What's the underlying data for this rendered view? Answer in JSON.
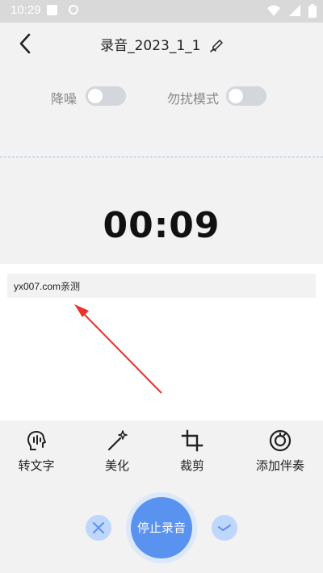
{
  "status_bar": {
    "time": "10:29",
    "icons": [
      "notification-icon",
      "sync-icon",
      "wifi-icon",
      "signal-icon",
      "battery-icon"
    ]
  },
  "header": {
    "title": "录音_2023_1_1",
    "back_icon": "chevron-left-icon",
    "edit_icon": "edit-pen-icon"
  },
  "toggles": [
    {
      "label": "降噪",
      "on": false
    },
    {
      "label": "勿扰模式",
      "on": false
    }
  ],
  "timer": "00:09",
  "transcript": {
    "text": "yx007.com亲测"
  },
  "tools": [
    {
      "label": "转文字",
      "icon": "speech-to-text-icon"
    },
    {
      "label": "美化",
      "icon": "magic-wand-icon"
    },
    {
      "label": "裁剪",
      "icon": "crop-icon"
    },
    {
      "label": "添加伴奏",
      "icon": "music-disc-icon"
    }
  ],
  "controls": {
    "cancel_icon": "close-icon",
    "record_label": "停止录音",
    "confirm_icon": "check-icon"
  },
  "colors": {
    "accent": "#5a92ef",
    "accent_light": "#bfd7fb",
    "background": "#f2f2f2",
    "annotation_arrow": "#e8322b"
  }
}
